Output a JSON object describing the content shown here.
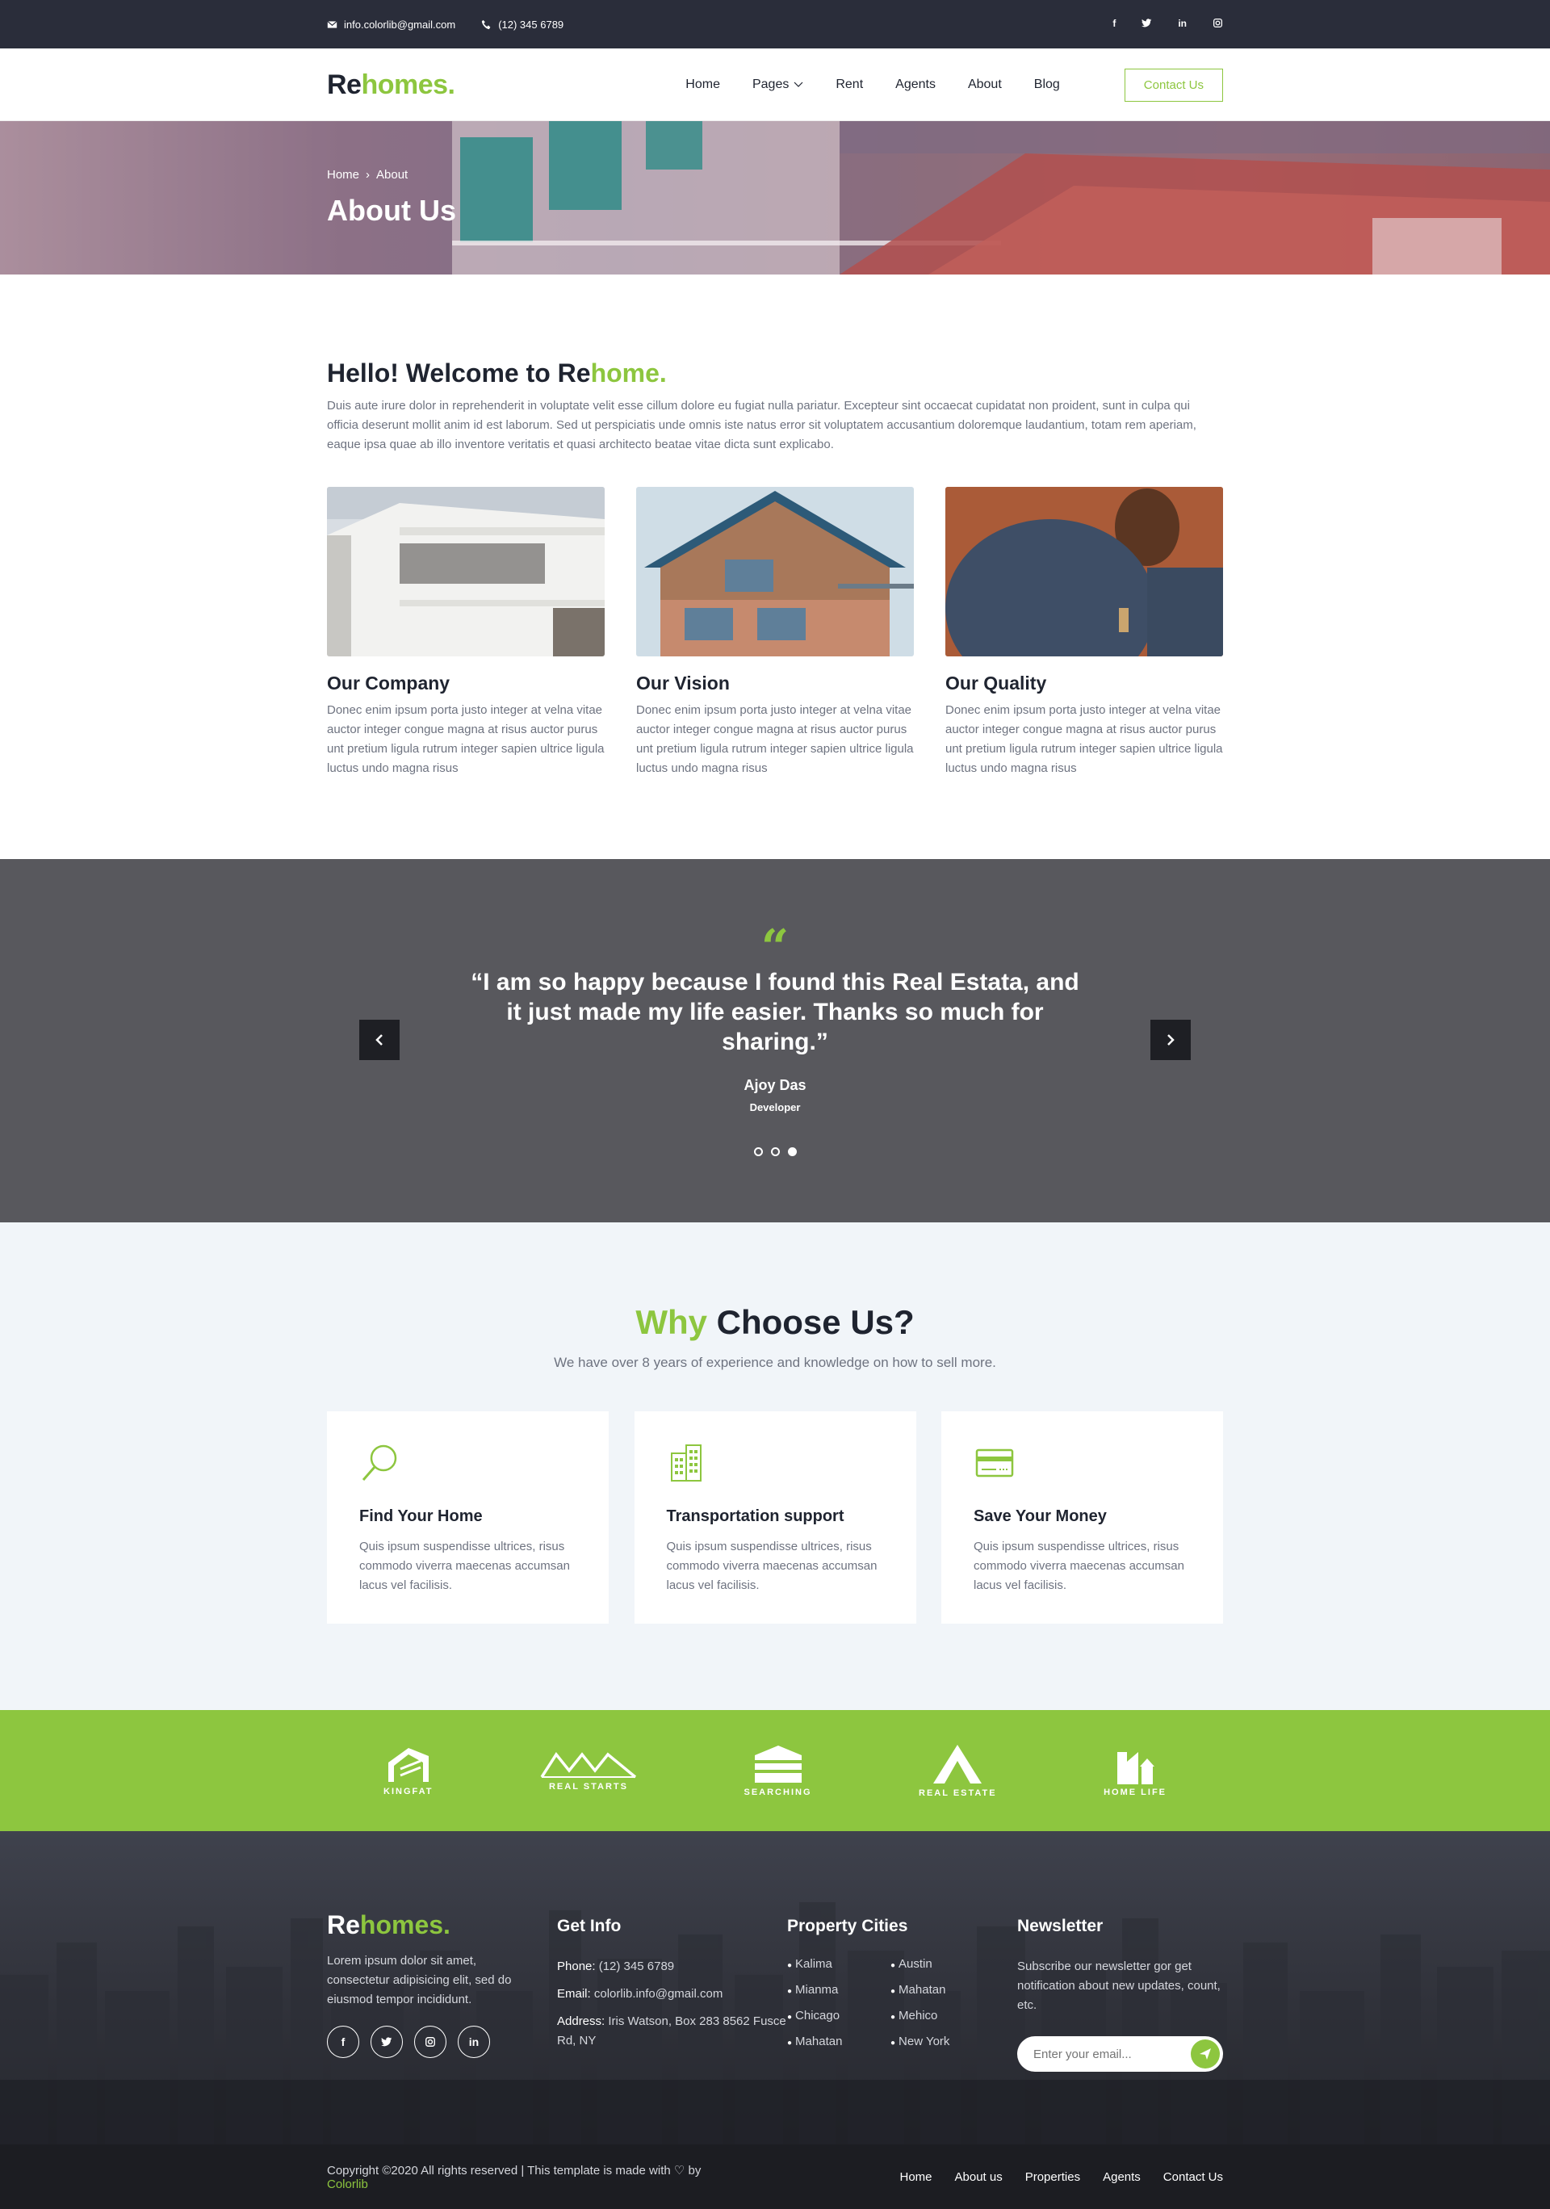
{
  "topbar": {
    "email": "info.colorlib@gmail.com",
    "phone": "(12) 345 6789",
    "social": [
      "f",
      "t",
      "in",
      "ig"
    ]
  },
  "header": {
    "logo_re": "Re",
    "logo_homes": "homes.",
    "nav": [
      "Home",
      "Pages",
      "Rent",
      "Agents",
      "About",
      "Blog"
    ],
    "contact": "Contact Us"
  },
  "hero": {
    "crumb_home": "Home",
    "crumb_current": "About",
    "title": "About Us"
  },
  "welcome": {
    "title_main": "Hello! Welcome to Re",
    "title_green": "home.",
    "text": "Duis aute irure dolor in reprehenderit in voluptate velit esse cillum dolore eu fugiat nulla pariatur. Excepteur sint occaecat cupidatat non proident, sunt in culpa qui officia deserunt mollit anim id est laborum. Sed ut perspiciatis unde omnis iste natus error sit voluptatem accusantium doloremque laudantium, totam rem aperiam, eaque ipsa quae ab illo inventore veritatis et quasi architecto beatae vitae dicta sunt explicabo.",
    "cards": [
      {
        "title": "Our Company",
        "text": "Donec enim ipsum porta justo integer at velna vitae auctor integer congue magna at risus auctor purus unt pretium ligula rutrum integer sapien ultrice ligula luctus undo magna risus"
      },
      {
        "title": "Our Vision",
        "text": "Donec enim ipsum porta justo integer at velna vitae auctor integer congue magna at risus auctor purus unt pretium ligula rutrum integer sapien ultrice ligula luctus undo magna risus"
      },
      {
        "title": "Our Quality",
        "text": "Donec enim ipsum porta justo integer at velna vitae auctor integer congue magna at risus auctor purus unt pretium ligula rutrum integer sapien ultrice ligula luctus undo magna risus"
      }
    ]
  },
  "testimonial": {
    "quote": "“I am so happy because I found this Real Estata, and it just made my life easier. Thanks so much for sharing.”",
    "author": "Ajoy Das",
    "role": "Developer",
    "active_slide": 3,
    "total_slides": 3
  },
  "why": {
    "title_green": "Why",
    "title_rest": " Choose Us?",
    "subtitle": "We have over 8 years of experience and knowledge on how to sell more.",
    "features": [
      {
        "icon": "search-icon",
        "title": "Find Your Home",
        "text": "Quis ipsum suspendisse ultrices, risus commodo viverra maecenas accumsan lacus vel facilisis."
      },
      {
        "icon": "building-icon",
        "title": "Transportation support",
        "text": "Quis ipsum suspendisse ultrices, risus commodo viverra maecenas accumsan lacus vel facilisis."
      },
      {
        "icon": "credit-card-icon",
        "title": "Save Your Money",
        "text": "Quis ipsum suspendisse ultrices, risus commodo viverra maecenas accumsan lacus vel facilisis."
      }
    ]
  },
  "brands": [
    "KINGFAT",
    "REAL STARTS",
    "SEARCHING",
    "REAL ESTATE",
    "HOME LIFE"
  ],
  "footer": {
    "logo_re": "Re",
    "logo_homes": "homes.",
    "desc": "Lorem ipsum dolor sit amet, consectetur adipisicing elit, sed do eiusmod tempor incididunt.",
    "getinfo_title": "Get Info",
    "phone_label": "Phone:",
    "phone": "(12) 345 6789",
    "email_label": "Email:",
    "email": "colorlib.info@gmail.com",
    "address_label": "Address:",
    "address": "Iris Watson, Box 283 8562 Fusce Rd, NY",
    "cities_title": "Property Cities",
    "cities": [
      "Kalima",
      "Austin",
      "Mianma",
      "Mahatan",
      "Chicago",
      "Mehico",
      "Mahatan",
      "New York"
    ],
    "newsletter_title": "Newsletter",
    "newsletter_text": "Subscribe our newsletter gor get notification about new updates, count, etc.",
    "newsletter_placeholder": "Enter your email...",
    "copyright": "Copyright ©2020 All rights reserved | This template is made with ♡ by",
    "copyright_brand": "Colorlib",
    "links": [
      "Home",
      "About us",
      "Properties",
      "Agents",
      "Contact Us"
    ]
  },
  "colors": {
    "accent": "#8dc63f",
    "dark": "#2a2d3a",
    "testimonial_bg": "#58585d"
  }
}
